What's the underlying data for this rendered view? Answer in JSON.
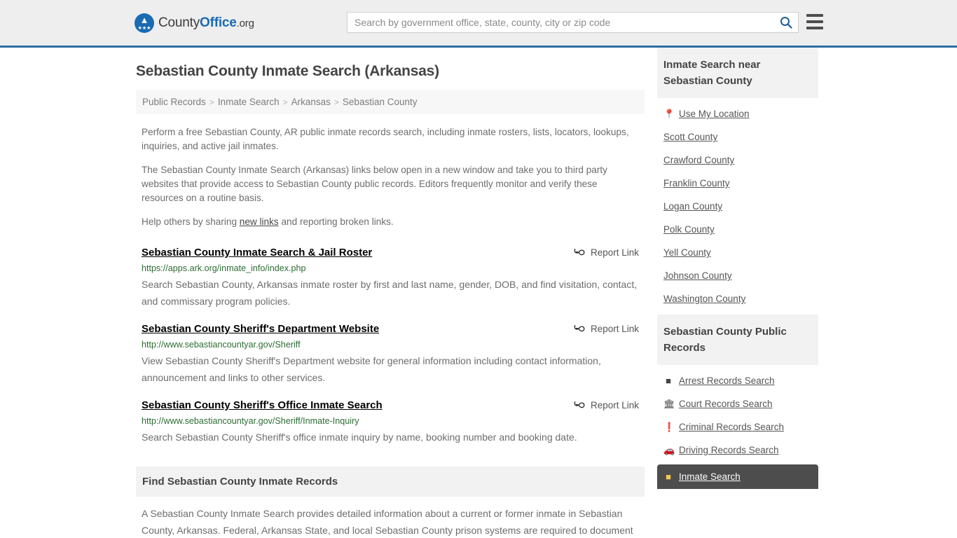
{
  "header": {
    "logo": {
      "part1": "County",
      "part2": "Office",
      "part3": ".org",
      "icon": "eagle-seal-icon",
      "stars": "★★★"
    },
    "search": {
      "placeholder": "Search by government office, state, county, city or zip code",
      "value": "",
      "icon": "search-icon"
    },
    "menu_icon": "hamburger-menu-icon"
  },
  "page": {
    "title": "Sebastian County Inmate Search (Arkansas)"
  },
  "breadcrumb": {
    "separator": ">",
    "items": [
      {
        "label": "Public Records"
      },
      {
        "label": "Inmate Search"
      },
      {
        "label": "Arkansas"
      },
      {
        "label": "Sebastian County"
      }
    ]
  },
  "intro": {
    "p1": "Perform a free Sebastian County, AR public inmate records search, including inmate rosters, lists, locators, lookups, inquiries, and active jail inmates.",
    "p2": "The Sebastian County Inmate Search (Arkansas) links below open in a new window and take you to third party websites that provide access to Sebastian County public records. Editors frequently monitor and verify these resources on a routine basis.",
    "p3_before": "Help others by sharing ",
    "p3_link": "new links",
    "p3_after": " and reporting broken links."
  },
  "results": {
    "report_label": "Report Link",
    "report_icon": "unlink-icon",
    "items": [
      {
        "title": "Sebastian County Inmate Search & Jail Roster",
        "url": "https://apps.ark.org/inmate_info/index.php",
        "description": "Search Sebastian County, Arkansas inmate roster by first and last name, gender, DOB, and find visitation, contact, and commissary program policies."
      },
      {
        "title": "Sebastian County Sheriff's Department Website",
        "url": "http://www.sebastiancountyar.gov/Sheriff",
        "description": "View Sebastian County Sheriff's Department website for general information including contact information, announcement and links to other services."
      },
      {
        "title": "Sebastian County Sheriff's Office Inmate Search",
        "url": "http://www.sebastiancountyar.gov/Sheriff/Inmate-Inquiry",
        "description": "Search Sebastian County Sheriff's office inmate inquiry by name, booking number and booking date."
      }
    ]
  },
  "find_section": {
    "heading": "Find Sebastian County Inmate Records",
    "paragraph": "A Sebastian County Inmate Search provides detailed information about a current or former inmate in Sebastian County, Arkansas. Federal, Arkansas State, and local Sebastian County prison systems are required to document"
  },
  "sidebar": {
    "near_box": {
      "heading": "Inmate Search near Sebastian County",
      "items": [
        {
          "label": "Use My Location",
          "icon": "map-pin-icon"
        },
        {
          "label": "Scott County",
          "icon": ""
        },
        {
          "label": "Crawford County",
          "icon": ""
        },
        {
          "label": "Franklin County",
          "icon": ""
        },
        {
          "label": "Logan County",
          "icon": ""
        },
        {
          "label": "Polk County",
          "icon": ""
        },
        {
          "label": "Yell County",
          "icon": ""
        },
        {
          "label": "Johnson County",
          "icon": ""
        },
        {
          "label": "Washington County",
          "icon": ""
        }
      ]
    },
    "records_box": {
      "heading": "Sebastian County Public Records",
      "items": [
        {
          "label": "Arrest Records Search",
          "icon": "fingerprint-icon",
          "active": false
        },
        {
          "label": "Court Records Search",
          "icon": "courthouse-icon",
          "active": false
        },
        {
          "label": "Criminal Records Search",
          "icon": "exclamation-icon",
          "active": false
        },
        {
          "label": "Driving Records Search",
          "icon": "car-icon",
          "active": false
        },
        {
          "label": "Inmate Search",
          "icon": "inmate-badge-icon",
          "active": true
        }
      ]
    }
  },
  "colors": {
    "header_bg": "#eeeeee",
    "header_border": "#2e6da4",
    "brand_blue": "#1a6bb3",
    "url_green": "#2d6e33",
    "panel_gray": "#f2f2f2",
    "active_dark": "#4d4d4d"
  }
}
